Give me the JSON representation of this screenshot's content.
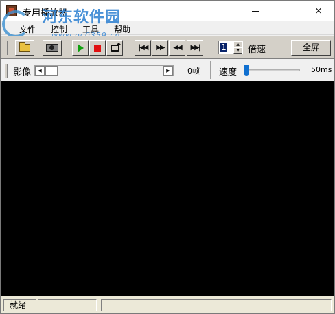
{
  "window": {
    "title": "专用播放器",
    "controls": {
      "minimize": "minimize",
      "maximize": "maximize",
      "close": "×"
    }
  },
  "menu": [
    {
      "label": "文件"
    },
    {
      "label": "控制"
    },
    {
      "label": "工具"
    },
    {
      "label": "帮助"
    }
  ],
  "watermark": {
    "brand": "河东软件园",
    "url": "www.pc0359.cn"
  },
  "toolbar": {
    "buttons": [
      {
        "name": "open-file",
        "icon": "folder-open-icon"
      },
      {
        "name": "capture",
        "icon": "camera-icon"
      },
      {
        "name": "play",
        "icon": "play-icon",
        "color": "#10a010"
      },
      {
        "name": "stop",
        "icon": "stop-icon",
        "color": "#e01010"
      },
      {
        "name": "loop",
        "icon": "loop-icon"
      },
      {
        "name": "first-frame",
        "icon": "skip-first-icon"
      },
      {
        "name": "fast-forward",
        "icon": "fast-forward-icon"
      },
      {
        "name": "rewind",
        "icon": "rewind-icon"
      },
      {
        "name": "last-frame",
        "icon": "skip-last-icon"
      }
    ],
    "speed_value": "1",
    "speed_label": "倍速",
    "fullscreen_label": "全屏"
  },
  "controls": {
    "image_label": "影像",
    "frame_value": "0帧",
    "speed_label": "速度",
    "speed_ms": "50ms",
    "speed_slider_fraction": 0
  },
  "status": {
    "text": "就绪",
    "panel2": "",
    "panel3": ""
  }
}
